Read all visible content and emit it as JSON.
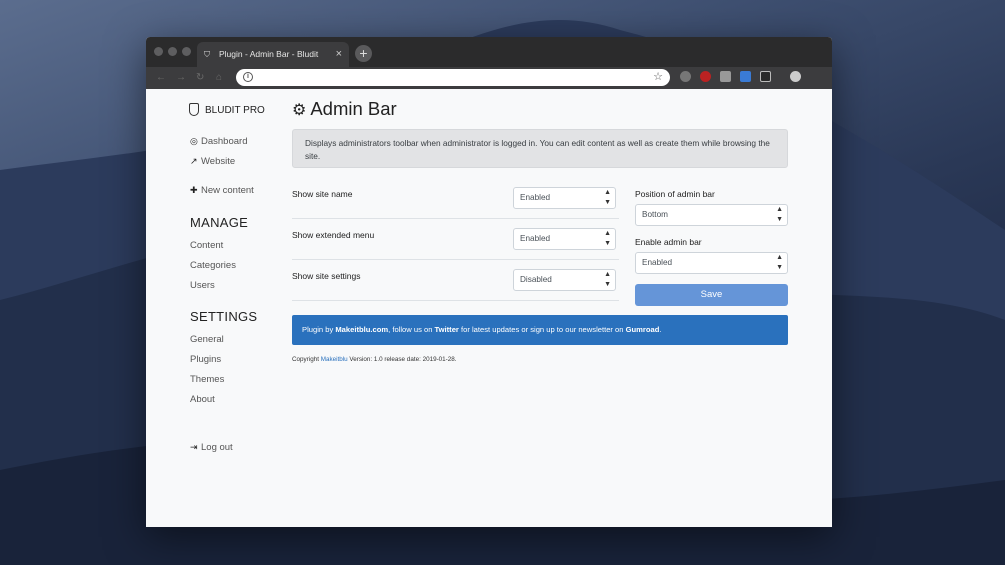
{
  "browser": {
    "tab_title": "Plugin - Admin Bar - Bludit",
    "tab_close": "×",
    "new_tab": "+",
    "url": ""
  },
  "sidebar": {
    "brand": "BLUDIT PRO",
    "links": [
      {
        "label": "Dashboard",
        "icon": "dashboard-icon"
      },
      {
        "label": "Website",
        "icon": "external-link-icon"
      },
      {
        "label": "New content",
        "icon": "plus-icon"
      }
    ],
    "manage": {
      "heading": "MANAGE",
      "items": [
        "Content",
        "Categories",
        "Users"
      ]
    },
    "settings": {
      "heading": "SETTINGS",
      "items": [
        "General",
        "Plugins",
        "Themes",
        "About"
      ]
    },
    "logout": "Log out"
  },
  "main": {
    "title": "Admin Bar",
    "description": "Displays administrators toolbar when administrator is logged in. You can edit content as well as create them while browsing the site.",
    "rows": [
      {
        "label": "Show site name",
        "value": "Enabled"
      },
      {
        "label": "Show extended menu",
        "value": "Enabled"
      },
      {
        "label": "Show site settings",
        "value": "Disabled"
      }
    ],
    "position_label": "Position of admin bar",
    "position_value": "Bottom",
    "enable_label": "Enable admin bar",
    "enable_value": "Enabled",
    "save_label": "Save",
    "banner": {
      "t1": "Plugin by ",
      "author": "Makeitblu.com",
      "t2": ", follow us on ",
      "twitter": "Twitter",
      "t3": " for latest updates or sign up to our newsletter on ",
      "gumroad": "Gumroad",
      "t4": "."
    },
    "copyright": {
      "prefix": "Copyright ",
      "link": "Makeitblu",
      "suffix": " Version: 1.0 release date: 2019-01-28."
    }
  },
  "colors": {
    "primary": "#6595d8",
    "banner": "#2a71bd"
  }
}
